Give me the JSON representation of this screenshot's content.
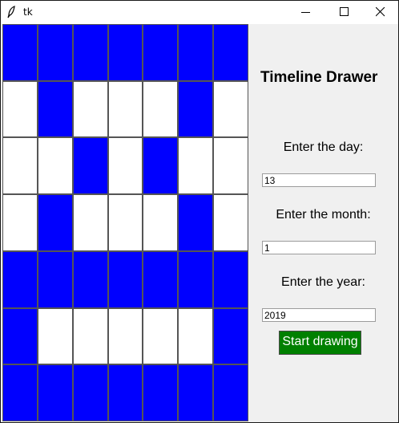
{
  "window": {
    "title": "tk"
  },
  "titlebar_icons": [
    "feather-icon",
    "minimize-icon",
    "maximize-icon",
    "close-icon"
  ],
  "grid": {
    "rows": 7,
    "cols": 7,
    "fill_color": "#0000ff",
    "empty_color": "#ffffff",
    "cells": [
      [
        1,
        1,
        1,
        1,
        1,
        1,
        1
      ],
      [
        0,
        1,
        0,
        0,
        0,
        1,
        0
      ],
      [
        0,
        0,
        1,
        0,
        1,
        0,
        0
      ],
      [
        0,
        1,
        0,
        0,
        0,
        1,
        0
      ],
      [
        1,
        1,
        1,
        1,
        1,
        1,
        1
      ],
      [
        1,
        0,
        0,
        0,
        0,
        0,
        1
      ],
      [
        1,
        1,
        1,
        1,
        1,
        1,
        1
      ]
    ]
  },
  "panel": {
    "heading": "Timeline Drawer",
    "day_label": "Enter the day:",
    "day_value": "13",
    "month_label": "Enter the month:",
    "month_value": "1",
    "year_label": "Enter the year:",
    "year_value": "2019",
    "start_button": "Start drawing",
    "start_button_color": "#008000"
  }
}
